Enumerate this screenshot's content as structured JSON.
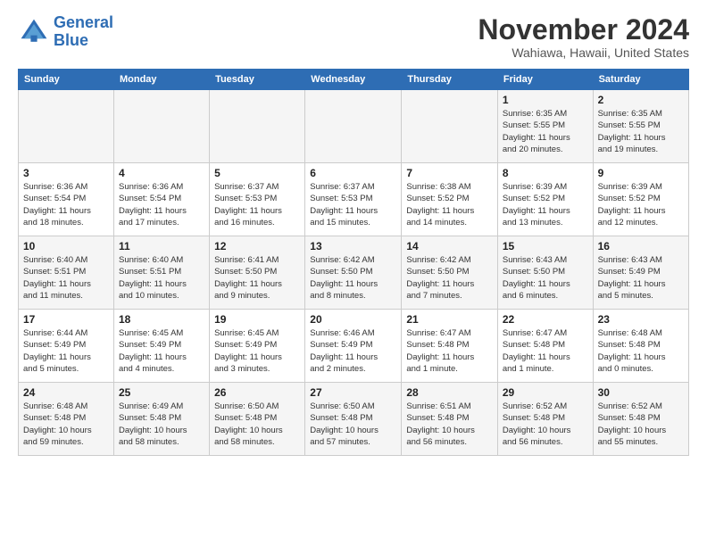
{
  "logo": {
    "line1": "General",
    "line2": "Blue"
  },
  "title": "November 2024",
  "subtitle": "Wahiawa, Hawaii, United States",
  "days_of_week": [
    "Sunday",
    "Monday",
    "Tuesday",
    "Wednesday",
    "Thursday",
    "Friday",
    "Saturday"
  ],
  "weeks": [
    [
      {
        "num": "",
        "info": ""
      },
      {
        "num": "",
        "info": ""
      },
      {
        "num": "",
        "info": ""
      },
      {
        "num": "",
        "info": ""
      },
      {
        "num": "",
        "info": ""
      },
      {
        "num": "1",
        "info": "Sunrise: 6:35 AM\nSunset: 5:55 PM\nDaylight: 11 hours\nand 20 minutes."
      },
      {
        "num": "2",
        "info": "Sunrise: 6:35 AM\nSunset: 5:55 PM\nDaylight: 11 hours\nand 19 minutes."
      }
    ],
    [
      {
        "num": "3",
        "info": "Sunrise: 6:36 AM\nSunset: 5:54 PM\nDaylight: 11 hours\nand 18 minutes."
      },
      {
        "num": "4",
        "info": "Sunrise: 6:36 AM\nSunset: 5:54 PM\nDaylight: 11 hours\nand 17 minutes."
      },
      {
        "num": "5",
        "info": "Sunrise: 6:37 AM\nSunset: 5:53 PM\nDaylight: 11 hours\nand 16 minutes."
      },
      {
        "num": "6",
        "info": "Sunrise: 6:37 AM\nSunset: 5:53 PM\nDaylight: 11 hours\nand 15 minutes."
      },
      {
        "num": "7",
        "info": "Sunrise: 6:38 AM\nSunset: 5:52 PM\nDaylight: 11 hours\nand 14 minutes."
      },
      {
        "num": "8",
        "info": "Sunrise: 6:39 AM\nSunset: 5:52 PM\nDaylight: 11 hours\nand 13 minutes."
      },
      {
        "num": "9",
        "info": "Sunrise: 6:39 AM\nSunset: 5:52 PM\nDaylight: 11 hours\nand 12 minutes."
      }
    ],
    [
      {
        "num": "10",
        "info": "Sunrise: 6:40 AM\nSunset: 5:51 PM\nDaylight: 11 hours\nand 11 minutes."
      },
      {
        "num": "11",
        "info": "Sunrise: 6:40 AM\nSunset: 5:51 PM\nDaylight: 11 hours\nand 10 minutes."
      },
      {
        "num": "12",
        "info": "Sunrise: 6:41 AM\nSunset: 5:50 PM\nDaylight: 11 hours\nand 9 minutes."
      },
      {
        "num": "13",
        "info": "Sunrise: 6:42 AM\nSunset: 5:50 PM\nDaylight: 11 hours\nand 8 minutes."
      },
      {
        "num": "14",
        "info": "Sunrise: 6:42 AM\nSunset: 5:50 PM\nDaylight: 11 hours\nand 7 minutes."
      },
      {
        "num": "15",
        "info": "Sunrise: 6:43 AM\nSunset: 5:50 PM\nDaylight: 11 hours\nand 6 minutes."
      },
      {
        "num": "16",
        "info": "Sunrise: 6:43 AM\nSunset: 5:49 PM\nDaylight: 11 hours\nand 5 minutes."
      }
    ],
    [
      {
        "num": "17",
        "info": "Sunrise: 6:44 AM\nSunset: 5:49 PM\nDaylight: 11 hours\nand 5 minutes."
      },
      {
        "num": "18",
        "info": "Sunrise: 6:45 AM\nSunset: 5:49 PM\nDaylight: 11 hours\nand 4 minutes."
      },
      {
        "num": "19",
        "info": "Sunrise: 6:45 AM\nSunset: 5:49 PM\nDaylight: 11 hours\nand 3 minutes."
      },
      {
        "num": "20",
        "info": "Sunrise: 6:46 AM\nSunset: 5:49 PM\nDaylight: 11 hours\nand 2 minutes."
      },
      {
        "num": "21",
        "info": "Sunrise: 6:47 AM\nSunset: 5:48 PM\nDaylight: 11 hours\nand 1 minute."
      },
      {
        "num": "22",
        "info": "Sunrise: 6:47 AM\nSunset: 5:48 PM\nDaylight: 11 hours\nand 1 minute."
      },
      {
        "num": "23",
        "info": "Sunrise: 6:48 AM\nSunset: 5:48 PM\nDaylight: 11 hours\nand 0 minutes."
      }
    ],
    [
      {
        "num": "24",
        "info": "Sunrise: 6:48 AM\nSunset: 5:48 PM\nDaylight: 10 hours\nand 59 minutes."
      },
      {
        "num": "25",
        "info": "Sunrise: 6:49 AM\nSunset: 5:48 PM\nDaylight: 10 hours\nand 58 minutes."
      },
      {
        "num": "26",
        "info": "Sunrise: 6:50 AM\nSunset: 5:48 PM\nDaylight: 10 hours\nand 58 minutes."
      },
      {
        "num": "27",
        "info": "Sunrise: 6:50 AM\nSunset: 5:48 PM\nDaylight: 10 hours\nand 57 minutes."
      },
      {
        "num": "28",
        "info": "Sunrise: 6:51 AM\nSunset: 5:48 PM\nDaylight: 10 hours\nand 56 minutes."
      },
      {
        "num": "29",
        "info": "Sunrise: 6:52 AM\nSunset: 5:48 PM\nDaylight: 10 hours\nand 56 minutes."
      },
      {
        "num": "30",
        "info": "Sunrise: 6:52 AM\nSunset: 5:48 PM\nDaylight: 10 hours\nand 55 minutes."
      }
    ]
  ]
}
